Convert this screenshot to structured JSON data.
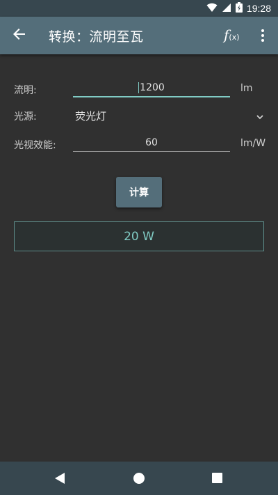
{
  "status_bar": {
    "time": "19:28"
  },
  "app_bar": {
    "title": "转换：流明至瓦",
    "fx_label": "f",
    "fx_sub": "(x)"
  },
  "form": {
    "lumens": {
      "label": "流明:",
      "value": "1200",
      "unit": "lm"
    },
    "source": {
      "label": "光源:",
      "value": "荧光灯"
    },
    "efficacy": {
      "label": "光视效能:",
      "value": "60",
      "unit": "lm/W"
    }
  },
  "calculate_label": "计算",
  "result": "20 W",
  "icons": {
    "back": "arrow-left-icon",
    "function": "function-fx-icon",
    "more": "more-vert-icon",
    "dropdown": "chevron-down-icon"
  },
  "colors": {
    "accent": "#80cbc4",
    "app_bar": "#546e7a",
    "background": "#303030"
  }
}
